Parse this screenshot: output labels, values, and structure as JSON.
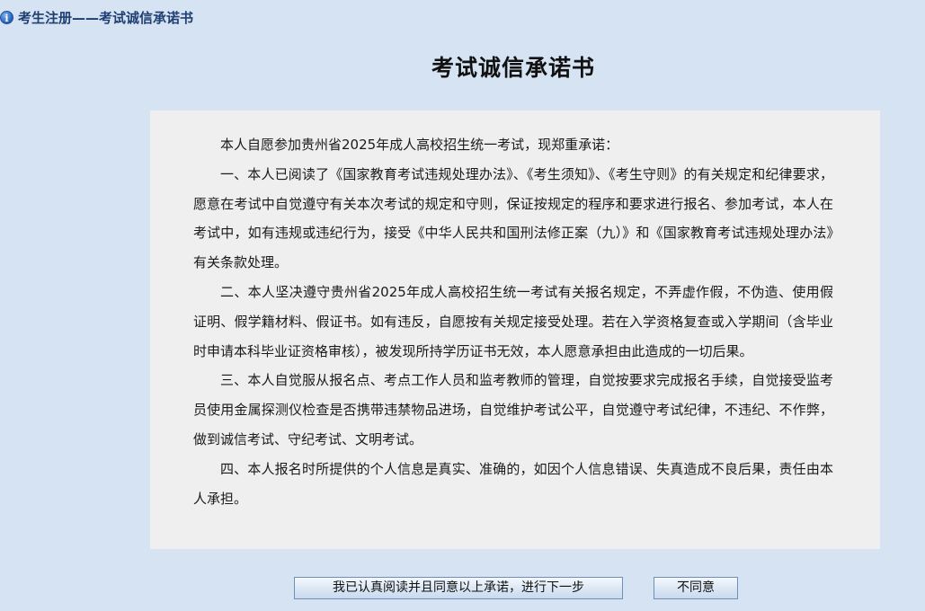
{
  "header": {
    "icon": "info-icon",
    "breadcrumb": "考生注册——考试诚信承诺书"
  },
  "main": {
    "title": "考试诚信承诺书",
    "paragraphs": [
      "本人自愿参加贵州省2025年成人高校招生统一考试，现郑重承诺：",
      "一、本人已阅读了《国家教育考试违规处理办法》、《考生须知》、《考生守则》的有关规定和纪律要求，愿意在考试中自觉遵守有关本次考试的规定和守则，保证按规定的程序和要求进行报名、参加考试，本人在考试中，如有违规或违纪行为，接受《中华人民共和国刑法修正案（九）》和《国家教育考试违规处理办法》有关条款处理。",
      "二、本人坚决遵守贵州省2025年成人高校招生统一考试有关报名规定，不弄虚作假，不伪造、使用假证明、假学籍材料、假证书。如有违反，自愿按有关规定接受处理。若在入学资格复查或入学期间（含毕业时申请本科毕业证资格审核），被发现所持学历证书无效，本人愿意承担由此造成的一切后果。",
      "三、本人自觉服从报名点、考点工作人员和监考教师的管理，自觉按要求完成报名手续，自觉接受监考员使用金属探测仪检查是否携带违禁物品进场，自觉维护考试公平，自觉遵守考试纪律，不违纪、不作弊，做到诚信考试、守纪考试、文明考试。",
      "四、本人报名时所提供的个人信息是真实、准确的，如因个人信息错误、失真造成不良后果，责任由本人承担。"
    ]
  },
  "actions": {
    "agree_label": "我已认真阅读并且同意以上承诺，进行下一步",
    "disagree_label": "不同意"
  },
  "colors": {
    "page_background": "#d6e3f3",
    "panel_background": "#efefef",
    "breadcrumb_text": "#1f3f73"
  }
}
